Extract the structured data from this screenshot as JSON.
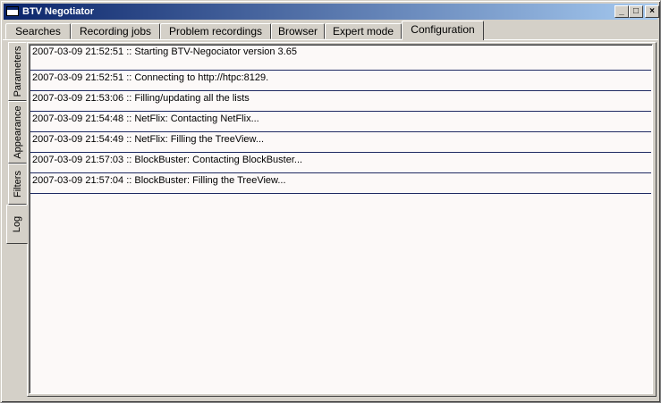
{
  "window": {
    "title": "BTV Negotiator",
    "controls": {
      "minimize": "_",
      "maximize": "□",
      "close": "×"
    }
  },
  "tabs": [
    {
      "label": "Searches"
    },
    {
      "label": "Recording jobs"
    },
    {
      "label": "Problem recordings"
    },
    {
      "label": "Browser"
    },
    {
      "label": "Expert mode"
    },
    {
      "label": "Configuration",
      "active": true
    }
  ],
  "config_tabs": [
    {
      "label": "Parameters"
    },
    {
      "label": "Appearance"
    },
    {
      "label": "Filters"
    },
    {
      "label": "Log",
      "active": true
    }
  ],
  "log": {
    "entries": [
      "2007-03-09 21:52:51 :: Starting BTV-Negociator version 3.65",
      "2007-03-09 21:52:51 :: Connecting to http://htpc:8129.",
      "2007-03-09 21:53:06 :: Filling/updating all the lists",
      "2007-03-09 21:54:48 ::  NetFlix: Contacting NetFlix...",
      "2007-03-09 21:54:49 ::  NetFlix: Filling the TreeView...",
      "2007-03-09 21:57:03 ::  BlockBuster: Contacting BlockBuster...",
      "2007-03-09 21:57:04 ::  BlockBuster: Filling the TreeView..."
    ]
  }
}
